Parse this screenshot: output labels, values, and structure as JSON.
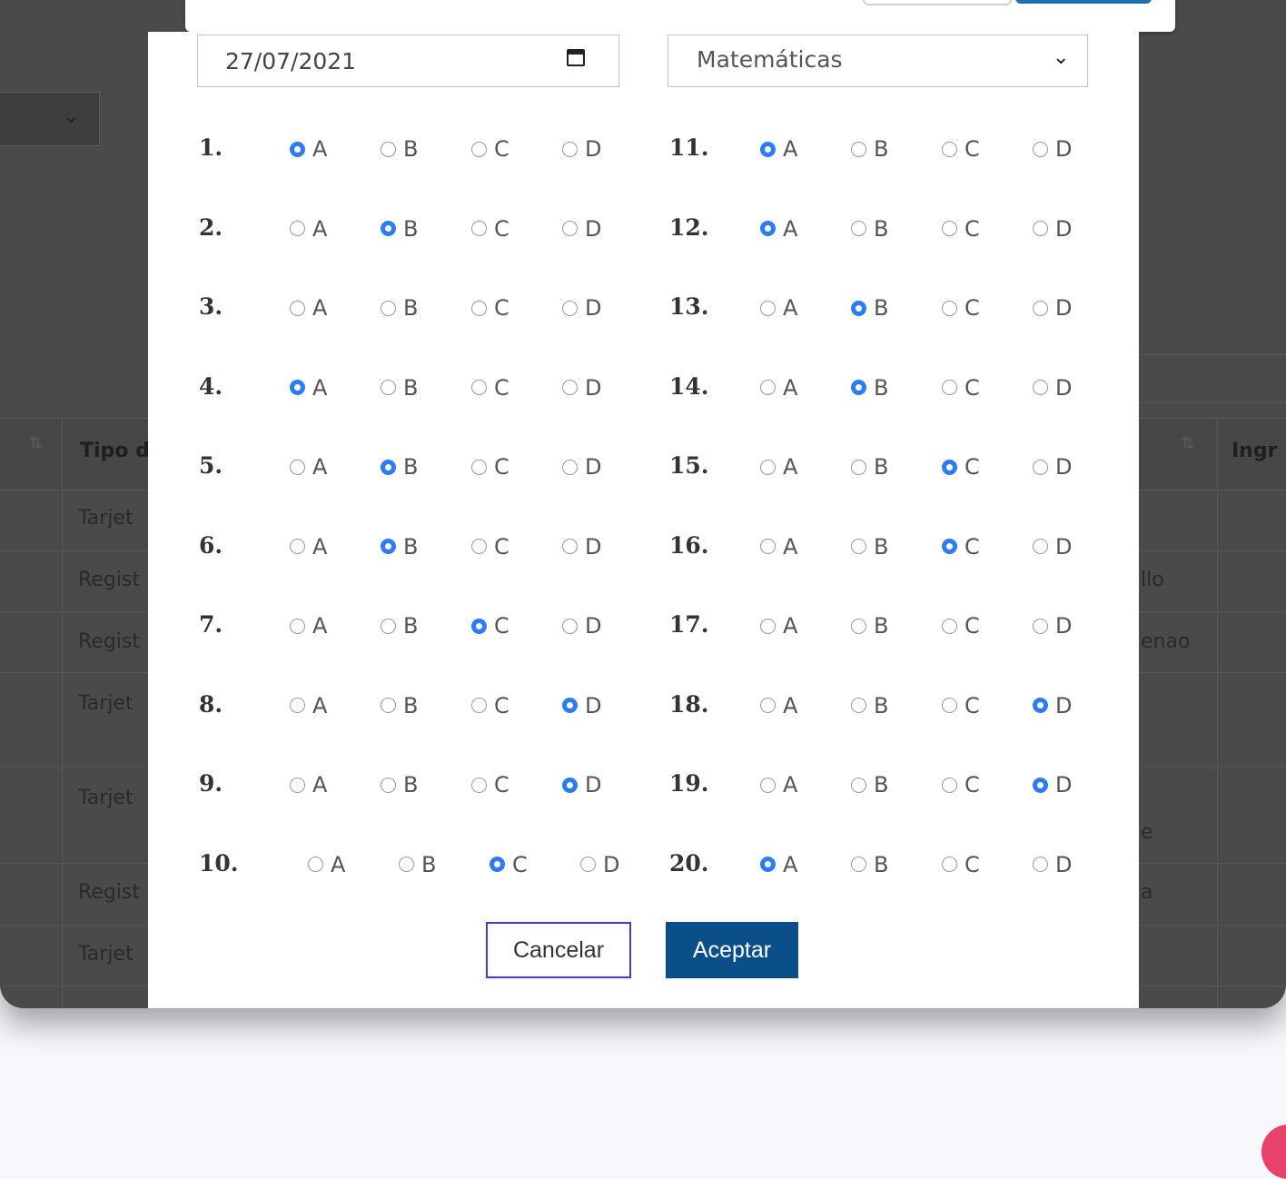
{
  "background": {
    "table_headers": [
      "Tipo d",
      "Ingr"
    ],
    "rows_left": [
      "Tarjet",
      "Regist",
      "Regist",
      "Tarjet",
      "Tarjet",
      "Regist",
      "Tarjet"
    ],
    "rows_right": [
      "llo",
      "enao",
      "e",
      "a"
    ]
  },
  "form": {
    "date_value": "27/07/2021",
    "subject_value": "Matemáticas"
  },
  "options": [
    "A",
    "B",
    "C",
    "D"
  ],
  "questions": [
    {
      "number": "1.",
      "selected": "A"
    },
    {
      "number": "2.",
      "selected": "B"
    },
    {
      "number": "3.",
      "selected": ""
    },
    {
      "number": "4.",
      "selected": "A"
    },
    {
      "number": "5.",
      "selected": "B"
    },
    {
      "number": "6.",
      "selected": "B"
    },
    {
      "number": "7.",
      "selected": "C"
    },
    {
      "number": "8.",
      "selected": "D"
    },
    {
      "number": "9.",
      "selected": "D"
    },
    {
      "number": "10.",
      "selected": "C"
    },
    {
      "number": "11.",
      "selected": "A"
    },
    {
      "number": "12.",
      "selected": "A"
    },
    {
      "number": "13.",
      "selected": "B"
    },
    {
      "number": "14.",
      "selected": "B"
    },
    {
      "number": "15.",
      "selected": "C"
    },
    {
      "number": "16.",
      "selected": "C"
    },
    {
      "number": "17.",
      "selected": ""
    },
    {
      "number": "18.",
      "selected": "D"
    },
    {
      "number": "19.",
      "selected": "D"
    },
    {
      "number": "20.",
      "selected": "A"
    }
  ],
  "buttons": {
    "cancel_label": "Cancelar",
    "accept_label": "Aceptar"
  },
  "colors": {
    "radio_checked": "#2b7cf6",
    "accept_bg": "#0b4f8a",
    "cancel_border": "#3b3bf0",
    "overlay": "#4a4a4a",
    "accent": "#e8416a"
  }
}
